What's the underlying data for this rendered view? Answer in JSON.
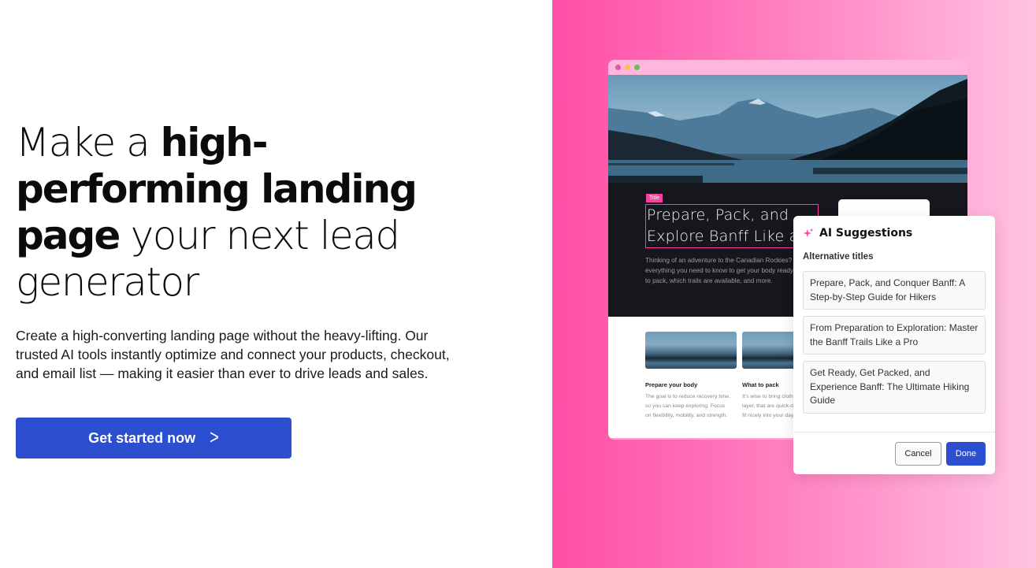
{
  "hero": {
    "headline_parts": [
      {
        "text": "Make a ",
        "bold": false
      },
      {
        "text": "high-performing landing page",
        "bold": true
      },
      {
        "text": " your next lead generator",
        "bold": false
      }
    ],
    "headline_light_1": "Make a ",
    "headline_bold_1": "high-",
    "headline_bold_2": "performing landing",
    "headline_bold_3": "page",
    "headline_light_2": " your next lead",
    "headline_light_3": "generator",
    "subtext": "Create a high-converting landing page without the heavy-lifting. Our trusted AI tools instantly optimize and connect your products, checkout, and email list — making it easier than ever to drive leads and sales.",
    "cta_label": "Get started now",
    "cta_icon": "chevron-right-icon",
    "cta_color": "#2b4fcf"
  },
  "panel": {
    "gradient_start": "#ff4fa6",
    "gradient_end": "#ffc3e2"
  },
  "mockup": {
    "window_controls": [
      "close",
      "minimize",
      "maximize"
    ],
    "title_tag": "Title",
    "title_line_1": "Prepare, Pack, and",
    "title_line_2": "Explore Banff Like a Pro",
    "description_lines": [
      "Thinking of an adventure to the Canadian Rockies? Here's",
      "everything you need to know to get your body ready, what",
      "to pack, which trails are available, and more."
    ],
    "cards": [
      {
        "title": "Prepare your body",
        "desc_lines": [
          "The goal is to reduce recovery time,",
          "so you can keep exploring. Focus",
          "on flexibility, mobility, and strength."
        ]
      },
      {
        "title": "What to pack",
        "desc_lines": [
          "It's wise to bring clothes in",
          "layer, that are quick-drying and",
          "fit nicely into your day pack."
        ]
      }
    ]
  },
  "ai_popup": {
    "icon": "sparkle-icon",
    "title": "AI Suggestions",
    "section_label": "Alternative titles",
    "suggestions": [
      "Prepare, Pack, and Conquer Banff: A Step-by-Step Guide for Hikers",
      "From Preparation to Exploration: Master the Banff Trails Like a Pro",
      "Get Ready, Get Packed, and Experience Banff: The Ultimate Hiking Guide"
    ],
    "cancel_label": "Cancel",
    "done_label": "Done",
    "accent_color": "#ff3fa0"
  }
}
